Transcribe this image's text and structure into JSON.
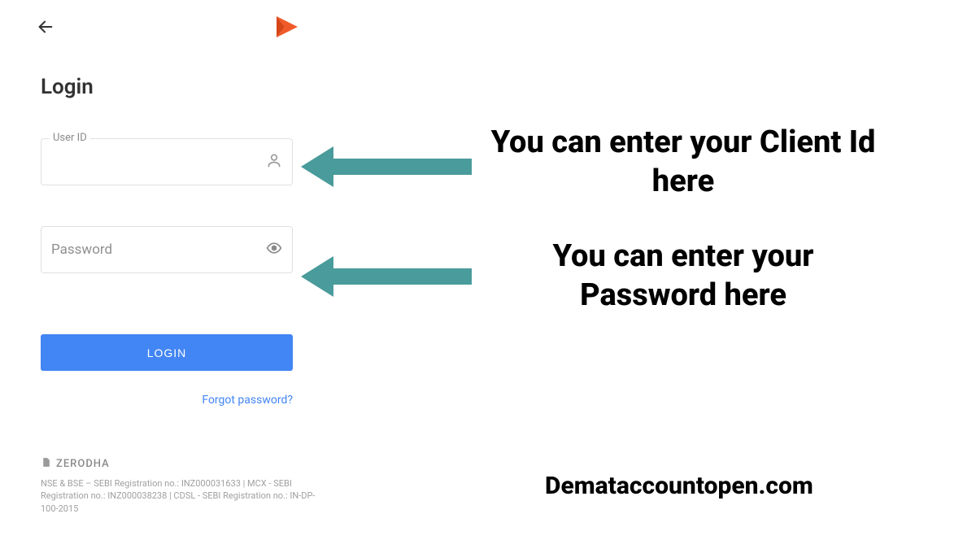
{
  "header": {
    "title": "Login"
  },
  "form": {
    "user_id_label": "User ID",
    "password_placeholder": "Password",
    "login_button": "LOGIN",
    "forgot_link": "Forgot password?"
  },
  "footer": {
    "brand": "ZERODHA",
    "registration": "NSE & BSE – SEBI Registration no.: INZ000031633 | MCX - SEBI Registration no.: INZ000038238 | CDSL - SEBI Registration no.: IN-DP-100-2015"
  },
  "annotations": {
    "callout_userid": "You can enter your Client Id here",
    "callout_password": "You can enter your Password here",
    "site_credit": "Demataccountopen.com"
  },
  "colors": {
    "arrow": "#4a9b9b",
    "primary_button": "#4285f4",
    "logo": "#f05a28"
  }
}
